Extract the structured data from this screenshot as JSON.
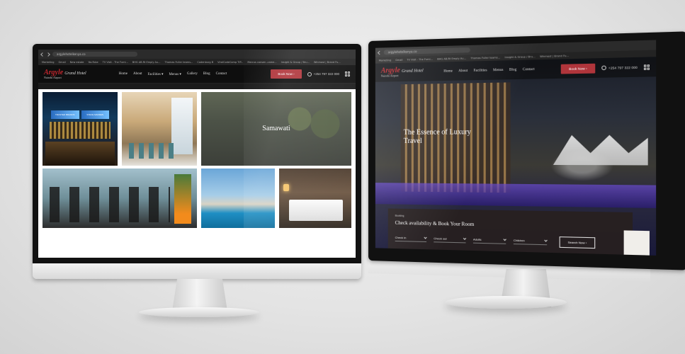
{
  "left_screen": {
    "url": "argylehotelkenya.co",
    "bookmarks": [
      "Marketing",
      "Gmail",
      "New estate",
      "YouTube",
      "TV Visit - The Furni...",
      "BHG AB.Rt Emply Au...",
      "Thomas Fuller teams...",
      "Codenburg B",
      "ViralCodeComp TIP...",
      "Marcus consen..came...",
      "Insight & Group / Bru...",
      "Winmost | Brand Fu..."
    ],
    "logo": {
      "brand": "Argyle",
      "suffix": "Grand Hotel",
      "location": "Nairobi Airport"
    },
    "menu": [
      "Home",
      "About",
      "Facilities ▾",
      "Menus ▾",
      "Gallery",
      "Blog",
      "Contact"
    ],
    "book_button": "Book Now ›",
    "phone": "+254 797 322 000",
    "gallery": {
      "bar_screens": [
        "TRUSTED BRANDS",
        "STEVE MADDEN"
      ],
      "feature_label": "Samawati"
    }
  },
  "right_screen": {
    "url": "argylehotelkenya.co",
    "logo": {
      "brand": "Argyle",
      "suffix": "Grand Hotel",
      "location": "Nairobi Airport"
    },
    "menu": [
      "Home",
      "About",
      "Facilities",
      "Menus",
      "Blog",
      "Contact"
    ],
    "book_button": "Book Now ›",
    "phone": "+254 797 322 000",
    "hero_title": "The Essence of Luxury Travel",
    "booking": {
      "eyebrow": "Booking",
      "heading": "Check availability & Book Your Room",
      "fields": [
        "Check in",
        "Check out",
        "Adults",
        "Children"
      ],
      "search_button": "Search Now ›"
    }
  },
  "colors": {
    "accent": "#b0353b",
    "header_bg": "#0e0e0e"
  },
  "icons": [
    "phone-icon",
    "grid-menu-icon",
    "back-arrow-icon",
    "forward-arrow-icon",
    "chevron-down-icon"
  ]
}
